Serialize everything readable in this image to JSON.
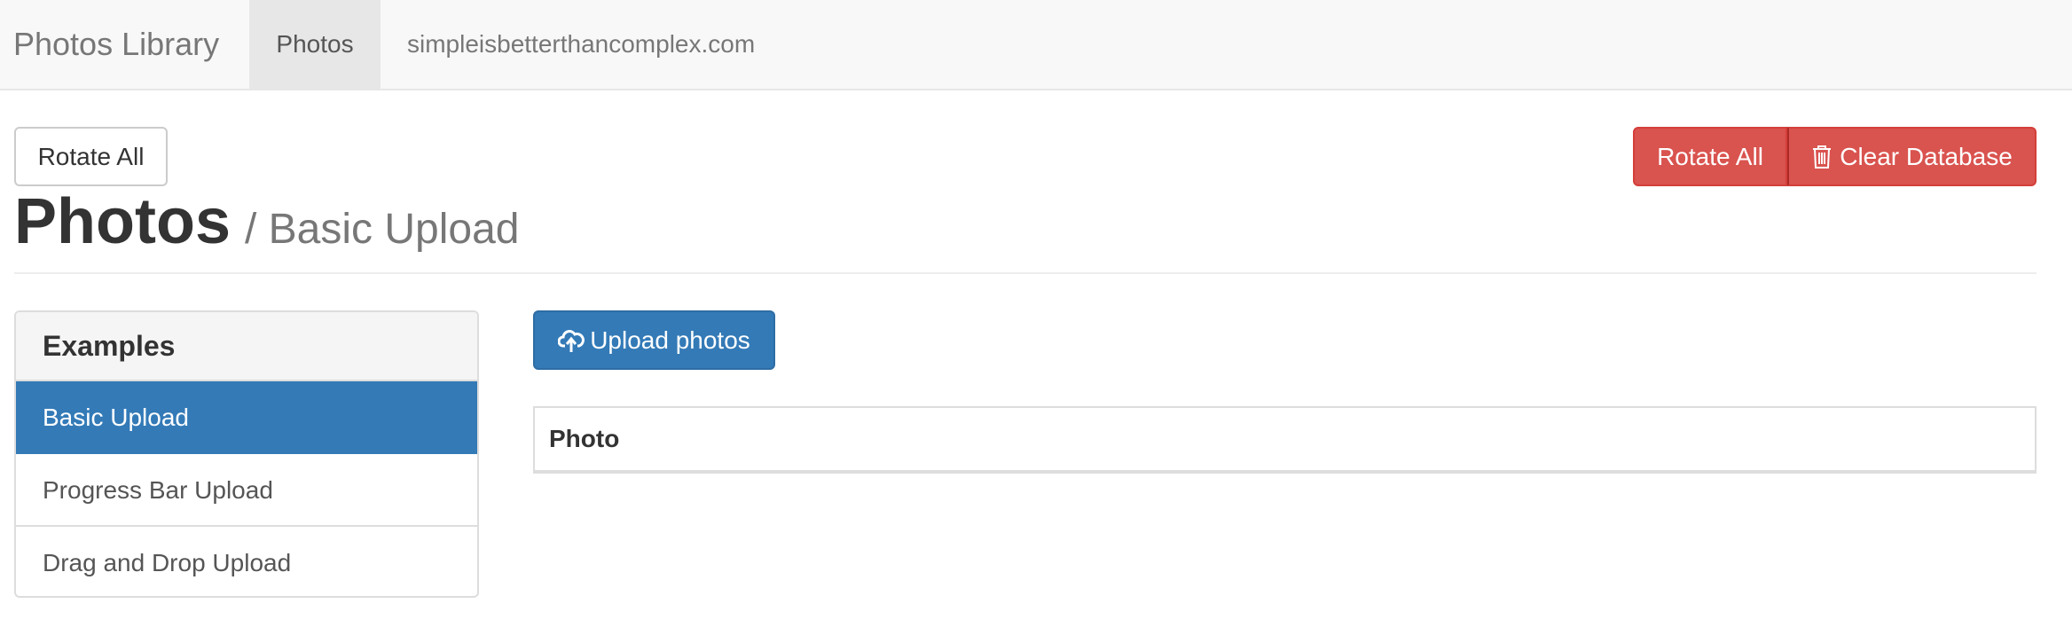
{
  "navbar": {
    "brand": "Photos Library",
    "items": [
      {
        "label": "Photos",
        "active": true
      },
      {
        "label": "simpleisbetterthancomplex.com",
        "active": false
      }
    ]
  },
  "toolbar": {
    "rotate_all_label": "Rotate All",
    "rotate_all_danger_label": "Rotate All",
    "clear_database_label": "Clear Database"
  },
  "page": {
    "title": "Photos",
    "subtitle": "/ Basic Upload"
  },
  "sidebar": {
    "heading": "Examples",
    "items": [
      {
        "label": "Basic Upload",
        "active": true
      },
      {
        "label": "Progress Bar Upload",
        "active": false
      },
      {
        "label": "Drag and Drop Upload",
        "active": false
      }
    ]
  },
  "main": {
    "upload_button_label": "Upload photos",
    "table": {
      "columns": [
        "Photo"
      ],
      "rows": []
    }
  },
  "icons": {
    "clear_database": "trash-icon",
    "upload": "cloud-upload-icon"
  },
  "colors": {
    "primary": "#337ab7",
    "danger": "#d9534f",
    "navbar_bg": "#f8f8f8"
  }
}
